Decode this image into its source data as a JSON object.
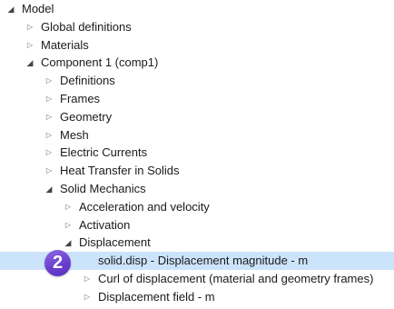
{
  "tree": {
    "nodes": [
      {
        "label": "Model",
        "toggle": "expanded",
        "toggle_icon": "collapse-triangle-icon",
        "depth": 0,
        "selected": false
      },
      {
        "label": "Global definitions",
        "toggle": "collapsed",
        "toggle_icon": "expand-triangle-icon",
        "depth": 1,
        "selected": false
      },
      {
        "label": "Materials",
        "toggle": "collapsed",
        "toggle_icon": "expand-triangle-icon",
        "depth": 1,
        "selected": false
      },
      {
        "label": "Component 1 (comp1)",
        "toggle": "expanded",
        "toggle_icon": "collapse-triangle-icon",
        "depth": 1,
        "selected": false
      },
      {
        "label": "Definitions",
        "toggle": "collapsed",
        "toggle_icon": "expand-triangle-icon",
        "depth": 2,
        "selected": false
      },
      {
        "label": "Frames",
        "toggle": "collapsed",
        "toggle_icon": "expand-triangle-icon",
        "depth": 2,
        "selected": false
      },
      {
        "label": "Geometry",
        "toggle": "collapsed",
        "toggle_icon": "expand-triangle-icon",
        "depth": 2,
        "selected": false
      },
      {
        "label": "Mesh",
        "toggle": "collapsed",
        "toggle_icon": "expand-triangle-icon",
        "depth": 2,
        "selected": false
      },
      {
        "label": "Electric Currents",
        "toggle": "collapsed",
        "toggle_icon": "expand-triangle-icon",
        "depth": 2,
        "selected": false
      },
      {
        "label": "Heat Transfer in Solids",
        "toggle": "collapsed",
        "toggle_icon": "expand-triangle-icon",
        "depth": 2,
        "selected": false
      },
      {
        "label": "Solid Mechanics",
        "toggle": "expanded",
        "toggle_icon": "collapse-triangle-icon",
        "depth": 2,
        "selected": false
      },
      {
        "label": "Acceleration and velocity",
        "toggle": "collapsed",
        "toggle_icon": "expand-triangle-icon",
        "depth": 3,
        "selected": false
      },
      {
        "label": "Activation",
        "toggle": "collapsed",
        "toggle_icon": "expand-triangle-icon",
        "depth": 3,
        "selected": false
      },
      {
        "label": "Displacement",
        "toggle": "expanded",
        "toggle_icon": "collapse-triangle-icon",
        "depth": 3,
        "selected": false
      },
      {
        "label": "solid.disp - Displacement magnitude - m",
        "toggle": "none",
        "toggle_icon": "",
        "depth": 4,
        "selected": true
      },
      {
        "label": "Curl of displacement (material and geometry frames)",
        "toggle": "collapsed",
        "toggle_icon": "expand-triangle-icon",
        "depth": 4,
        "selected": false
      },
      {
        "label": "Displacement field - m",
        "toggle": "collapsed",
        "toggle_icon": "expand-triangle-icon",
        "depth": 4,
        "selected": false
      }
    ],
    "selection_color": "#cce4fb"
  },
  "callout": {
    "number": "2",
    "color": "#6a3fcf"
  }
}
